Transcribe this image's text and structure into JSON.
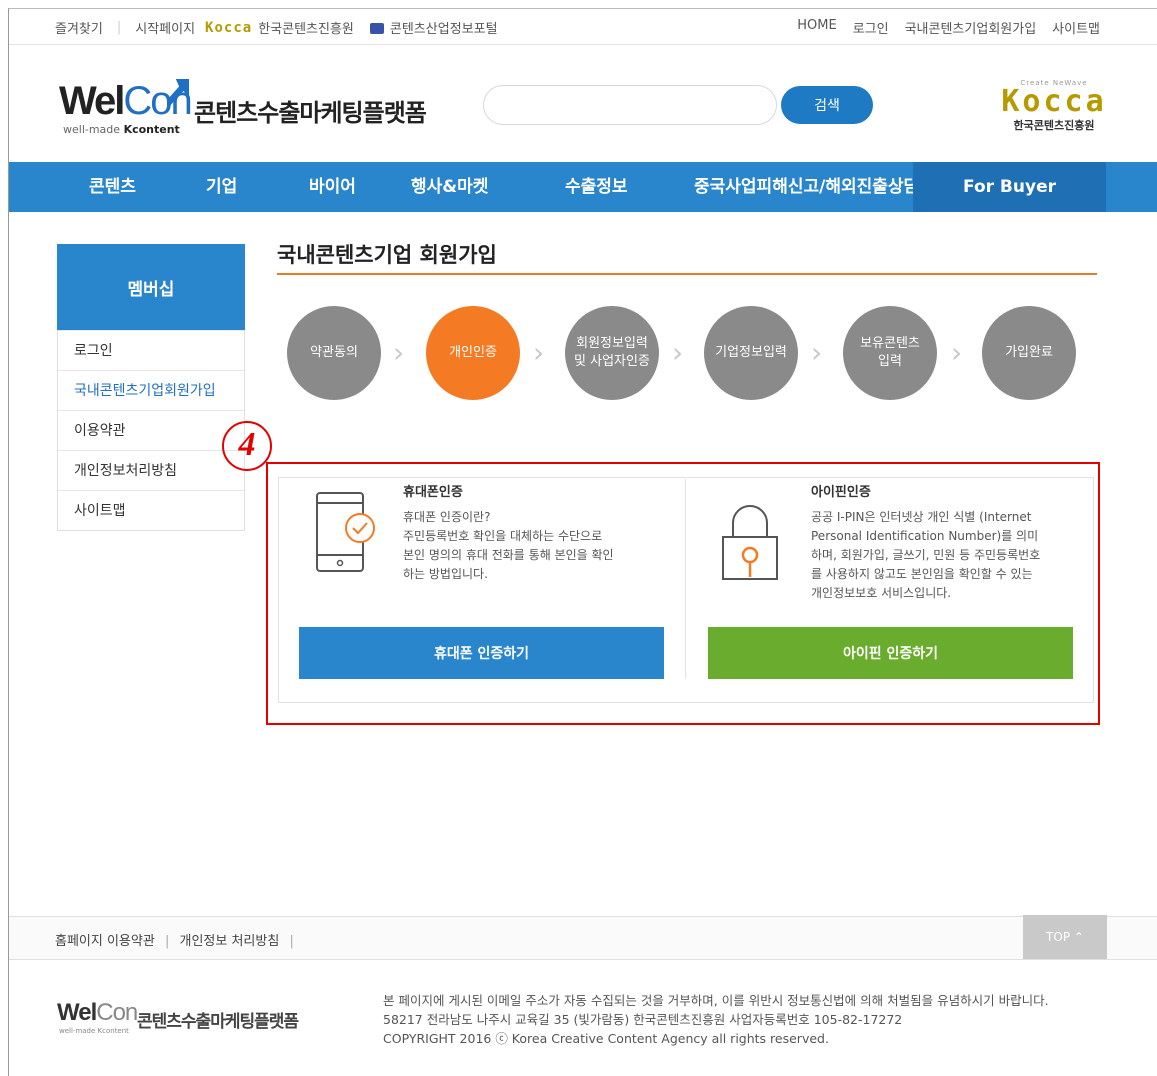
{
  "util": {
    "bookmark": "즐겨찾기",
    "startpage": "시작페이지",
    "kocca_mini": "Kocca",
    "agency": "한국콘텐츠진흥원",
    "portal": "콘텐츠산업정보포털",
    "home": "HOME",
    "login": "로그인",
    "join": "국내콘텐츠기업회원가입",
    "sitemap": "사이트맵"
  },
  "header": {
    "logo_wel": "Wel",
    "logo_con": "Con",
    "logo_tag_prefix": "well-made ",
    "logo_tag_brand": "Kcontent",
    "site_title": "콘텐츠수출마케팅플랫폼",
    "search_value": "",
    "search_button": "검색",
    "kocca_top": "Create NeWave",
    "kocca": "Kocca",
    "kocca_kr": "한국콘텐츠진흥원"
  },
  "nav": {
    "items": [
      "콘텐츠",
      "기업",
      "바이어",
      "행사&마켓",
      "수출정보",
      "중국사업피해신고/해외진출상담"
    ],
    "buyer": "For Buyer"
  },
  "sidebar": {
    "heading": "멤버십",
    "items": [
      "로그인",
      "국내콘텐츠기업회원가입",
      "이용약관",
      "개인정보처리방침",
      "사이트맵"
    ]
  },
  "page": {
    "title": "국내콘텐츠기업 회원가입",
    "steps": [
      "약관동의",
      "개인인증",
      "회원정보입력\n및 사업자인증",
      "기업정보입력",
      "보유콘텐츠\n입력",
      "가입완료"
    ],
    "marker": "4"
  },
  "phone": {
    "title": "휴대폰인증",
    "desc": "휴대폰 인증이란?\n주민등록번호 확인을 대체하는 수단으로\n본인 명의의 휴대 전화를 통해 본인을 확인\n하는 방법입니다.",
    "button": "휴대폰 인증하기"
  },
  "ipin": {
    "title": "아이핀인증",
    "desc": "공공 I-PIN은 인터넷상 개인 식별 (Internet\nPersonal Identification Number)를 의미\n하며, 회원가입, 글쓰기, 민원 등 주민등록번호\n를 사용하지 않고도 본인임을 확인할 수 있는\n개인정보보호 서비스입니다.",
    "button": "아이핀 인증하기"
  },
  "footer": {
    "terms": "홈페이지 이용약관",
    "privacy": "개인정보 처리방침",
    "top": "TOP ⌃",
    "logo_wel": "Wel",
    "logo_con": "Con",
    "logo_tag": "well-made Kcontent",
    "site_title": "콘텐츠수출마케팅플랫폼",
    "notice": "본 페이지에 게시된 이메일 주소가 자동 수집되는 것을 거부하며, 이를 위반시 정보통신법에 의해 처벌됨을 유념하시기 바랍니다.",
    "address": "58217 전라남도 나주시 교육길 35 (빛가람동) 한국콘텐츠진흥원 사업자등록번호 105-82-17272",
    "copyright": "COPYRIGHT 2016 ⓒ Korea Creative Content Agency all rights reserved."
  },
  "colors": {
    "primary": "#2a86cc",
    "active_step": "#f47a24",
    "green": "#6aad2e",
    "annotation": "#e40000"
  }
}
